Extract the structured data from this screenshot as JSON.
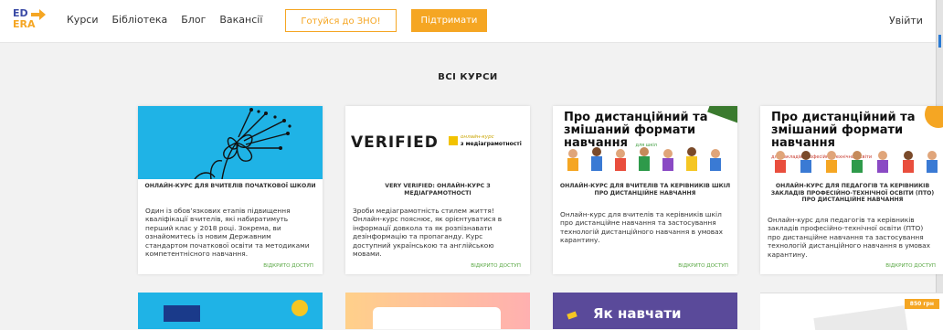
{
  "logo": {
    "line1": "ED",
    "line2": "ERA"
  },
  "nav": [
    "Курси",
    "Бібліотека",
    "Блог",
    "Вакансії"
  ],
  "buttons": {
    "zno": "Готуйся до ЗНО!",
    "support": "Підтримати",
    "login": "Увійти"
  },
  "section_title": "ВСІ КУРСИ",
  "colors": {
    "accent": "#f5a623",
    "link_green": "#5aa845",
    "brand_blue": "#3a4aa6"
  },
  "cards": [
    {
      "title": "Онлайн-курс для вчителів початкової школи",
      "desc": "Один із обов’язкових етапів підвищення кваліфікації вчителів, які набиратимуть перший клас у 2018 році. Зокрема, ви ознайомитесь із новим Державним стандартом початкової освіти та методиками компетентнісного навчання.",
      "footer": "Відкрито доступ"
    },
    {
      "verified_logo": "VERIFIED",
      "verified_tag1": "онлайн-курс",
      "verified_tag2": "з медіаграмотності",
      "title": "Very Verified: онлайн-курс з медіаграмотності",
      "desc": "Зроби медіаграмотність стилем життя! Онлайн-курс пояснює, як орієнтуватися в інформації довкола та як розпізнавати дезінформацію та пропаганду. Курс доступний українською та англійською мовами.",
      "footer": "Відкрито доступ"
    },
    {
      "promo_title": "Про дистанційний та змішаний формати навчання",
      "promo_sub": "для шкіл",
      "title": "Онлайн-курс для вчителів та керівників шкіл про дистанційне навчання",
      "desc": "Онлайн-курс для вчителів та керівників шкіл про дистанційне навчання та застосування технологій дистанційного навчання в умовах карантину.",
      "footer": "Відкрито доступ"
    },
    {
      "promo_title": "Про дистанційний та змішаний формати навчання",
      "promo_sub": "для закладів професійно-технічної освіти",
      "title": "Онлайн-курс для педагогів та керівників закладів професійно-технічної освіти (ПТО) про дистанційне навчання",
      "desc": "Онлайн-курс для педагогів та керівників закладів професійно-технічної освіти (ПТО) про дистанційне навчання та застосування технологій дистанційного навчання в умовах карантину.",
      "footer": "Відкрито доступ"
    }
  ],
  "second_row": {
    "card3_title": "Як навчати",
    "card4_price": "850 грн"
  }
}
